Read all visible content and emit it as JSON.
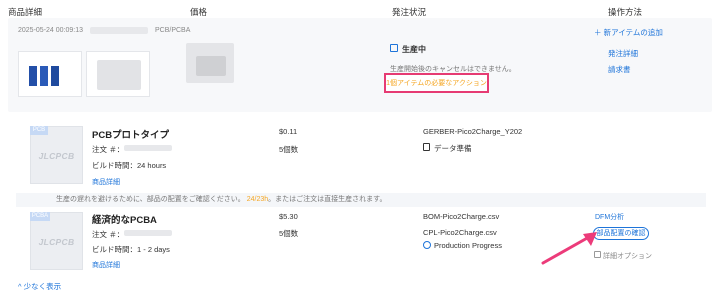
{
  "header": {
    "col_details": "商品詳細",
    "col_price": "価格",
    "col_status": "発注状況",
    "col_actions": "操作方法"
  },
  "order": {
    "timestamp": "2025-05-24 00:09:13",
    "type": "PCB/PCBA",
    "add_new_item": "＋ 新アイテムの追加",
    "status_label": "生産中",
    "status_note": "生産開始後のキャンセルはできません。",
    "action_required": "1個アイテムの必要なアクション",
    "order_details_link": "発注詳細",
    "invoice_link": "請求書"
  },
  "items": [
    {
      "chip": "PCB",
      "watermark": "JLCPCB",
      "title": "PCBプロトタイプ",
      "order_no_label": "注文 ＃：",
      "build_time": "ビルド時間：24 hours",
      "details_link": "商品詳細",
      "price": "$0.11",
      "qty": "5個数",
      "file": "GERBER-Pico2Charge_Y202",
      "status": "データ準備"
    },
    {
      "chip": "PCBA",
      "watermark": "JLCPCB",
      "title": "経済的なPCBA",
      "order_no_label": "注文 ＃：",
      "build_time": "ビルド時間：1 - 2 days",
      "details_link": "商品詳細",
      "price": "$5.30",
      "qty": "5個数",
      "file_bom": "BOM-Pico2Charge.csv",
      "file_cpl": "CPL-Pico2Charge.csv",
      "status": "Production Progress",
      "dfm_link": "DFM分析",
      "confirm_button": "部品配置の確認",
      "detail_options": "詳細オプション"
    }
  ],
  "notice": {
    "before": "生産の遅れを避けるために、部品の配置をご確認ください。",
    "highlight": "24/23h",
    "after": "。またはご注文は直接生産されます。"
  },
  "footer": {
    "show_less": "少なく表示"
  },
  "colors": {
    "link": "#1e74d9",
    "highlight_border": "#e63b73",
    "warning": "#f5a623",
    "arrow": "#ec3b7a"
  }
}
